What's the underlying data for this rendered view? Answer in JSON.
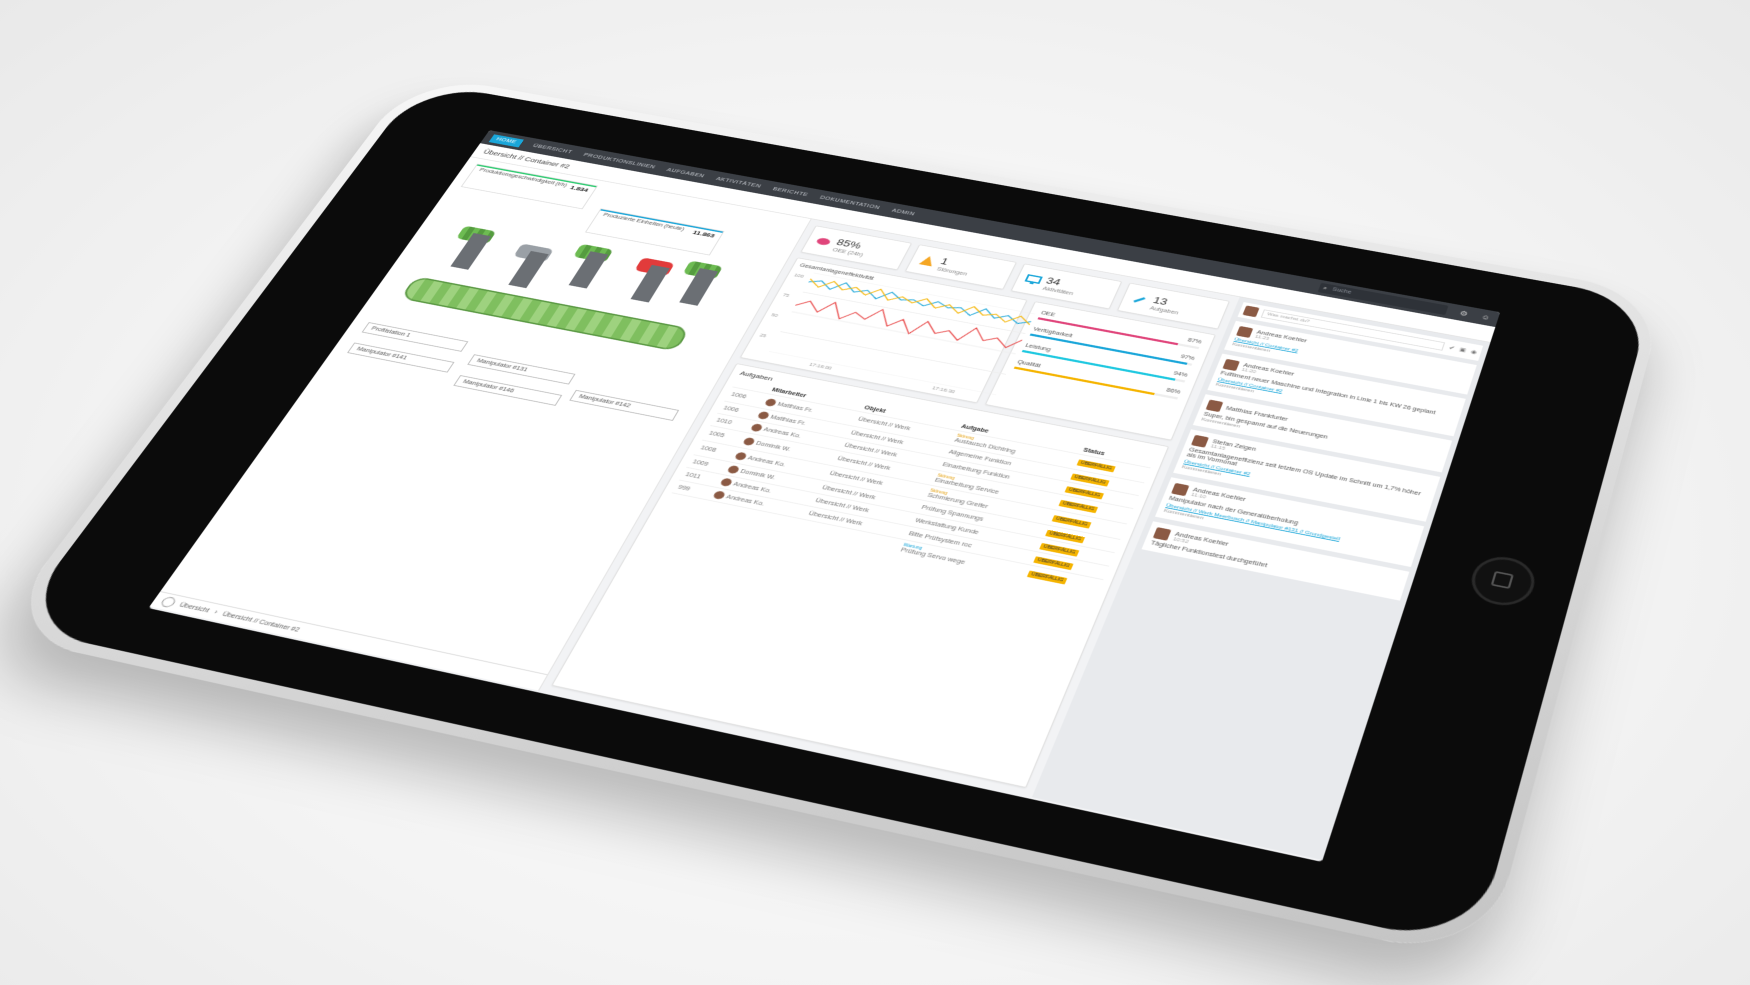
{
  "app": {
    "nav": [
      "Home",
      "Übersicht",
      "Produktionslinien",
      "Aufgaben",
      "Aktivitäten",
      "Berichte",
      "Dokumentation",
      "Admin"
    ],
    "search_placeholder": "Suche",
    "page_title": "Übersicht // Container #2"
  },
  "left_panel": {
    "kpi1": {
      "label": "Produktionsgeschwindigkeit (t/h)",
      "value": "1.834"
    },
    "kpi2": {
      "label": "Produzierte Einheiten (heute)",
      "value": "11.863"
    },
    "labels": [
      "Profilstation 1",
      "Manipulator #141",
      "Manipulator #131",
      "Manipulator #142",
      "Manipulator #146"
    ],
    "breadcrumb": [
      "Übersicht",
      "Übersicht // Container #2"
    ]
  },
  "stats": [
    {
      "icon": "brain-icon",
      "value": "85%",
      "label": "OEE (24h)",
      "color": "#e0457b"
    },
    {
      "icon": "warning-icon",
      "value": "1",
      "label": "Störungen",
      "color": "#f5a623"
    },
    {
      "icon": "monitor-icon",
      "value": "34",
      "label": "Aktivitäten",
      "color": "#1aa6d9"
    },
    {
      "icon": "wrench-icon",
      "value": "13",
      "label": "Aufgaben",
      "color": "#1aa6d9"
    }
  ],
  "chart_data": {
    "type": "line",
    "title": "Gesamtanlageneffektivität",
    "x": [
      "17:16:00",
      "17:16:30"
    ],
    "ylim": [
      0,
      100
    ],
    "yticks": [
      "100",
      "75",
      "50",
      "25"
    ],
    "series": [
      {
        "color": "#1aa6d9",
        "values": [
          88,
          92,
          84,
          95,
          86,
          91,
          83,
          94,
          87,
          90,
          85,
          93,
          88,
          91,
          84,
          95,
          86,
          92,
          85,
          90
        ]
      },
      {
        "color": "#f5b400",
        "values": [
          92,
          84,
          94,
          86,
          92,
          85,
          95,
          84,
          91,
          86,
          94,
          85,
          92,
          84,
          95,
          87,
          91,
          84,
          94,
          86
        ]
      },
      {
        "color": "#e84545",
        "values": [
          58,
          66,
          55,
          70,
          52,
          63,
          57,
          72,
          54,
          65,
          50,
          68,
          56,
          62,
          53,
          71,
          58,
          64,
          55,
          67
        ]
      }
    ]
  },
  "oee_breakdown": [
    {
      "label": "OEE",
      "value": "87%",
      "fraction": 0.87,
      "color": "#e0457b"
    },
    {
      "label": "Verfügbarkeit",
      "value": "97%",
      "fraction": 0.97,
      "color": "#1aa6d9"
    },
    {
      "label": "Leistung",
      "value": "94%",
      "fraction": 0.94,
      "color": "#1fc8e0"
    },
    {
      "label": "Qualität",
      "value": "86%",
      "fraction": 0.86,
      "color": "#f5b400"
    }
  ],
  "tasks": {
    "title": "Aufgaben",
    "columns": [
      "",
      "Mitarbeiter",
      "Objekt",
      "Aufgabe",
      "Status"
    ],
    "rows": [
      {
        "id": "1006",
        "who": "Matthias Fr.",
        "obj": "Übersicht // Werk",
        "tag": "Störung",
        "task": "Austausch Dichtring",
        "status": "ÜBERFÄLLIG"
      },
      {
        "id": "1006",
        "who": "Matthias Fr.",
        "obj": "Übersicht // Werk",
        "tag": "",
        "task": "Allgemeine Funktion",
        "status": "ÜBERFÄLLIG"
      },
      {
        "id": "1010",
        "who": "Andreas Ko.",
        "obj": "Übersicht // Werk",
        "tag": "",
        "task": "Einarbeitung Funktion",
        "status": "ÜBERFÄLLIG"
      },
      {
        "id": "1005",
        "who": "Dominik W.",
        "obj": "Übersicht // Werk",
        "tag": "Störung",
        "task": "Einarbeitung Service",
        "status": "ÜBERFÄLLIG"
      },
      {
        "id": "1008",
        "who": "Andreas Ko.",
        "obj": "Übersicht // Werk",
        "tag": "Störung",
        "task": "Schmierung Greifer",
        "status": "ÜBERFÄLLIG"
      },
      {
        "id": "1009",
        "who": "Dominik W.",
        "obj": "Übersicht // Werk",
        "tag": "",
        "task": "Prüfung Spannungs",
        "status": "ÜBERFÄLLIG"
      },
      {
        "id": "1011",
        "who": "Andreas Ko.",
        "obj": "Übersicht // Werk",
        "tag": "",
        "task": "Werkstattung Kunde",
        "status": "ÜBERFÄLLIG"
      },
      {
        "id": "999",
        "who": "Andreas Ko.",
        "obj": "Übersicht // Werk",
        "tag": "",
        "task": "Bitte Prüfsystem roc",
        "status": "ÜBERFÄLLIG"
      },
      {
        "id": "",
        "who": "",
        "obj": "",
        "tag": "Wartung",
        "task": "Prüfung Servo wege",
        "status": "ÜBERFÄLLIG"
      }
    ]
  },
  "feed": {
    "input_placeholder": "Was machst du?",
    "posts": [
      {
        "name": "Andreas Koehler",
        "time": "11:23",
        "text": "",
        "link": "Übersicht // Container #2",
        "meta": "Kommentieren"
      },
      {
        "name": "Andreas Koehler",
        "time": "11:20",
        "text": "Fulfilment neuer Maschine und Integration in Linie 1 bis KW 26 geplant",
        "link": "Übersicht // Container #2",
        "meta": "Kommentieren"
      },
      {
        "name": "Matthias Frankfurter",
        "time": "",
        "text": "Super, bin gespannt auf die Neuerungen",
        "link": "",
        "meta": "Kommentieren"
      },
      {
        "name": "Stefan Zeigen",
        "time": "11:15",
        "text": "Gesamtanlageneffizienz seit letztem OS Update im Schnitt um 1,7% höher als im Vormonat",
        "link": "Übersicht // Container #2",
        "meta": "Kommentieren"
      },
      {
        "name": "Andreas Koehler",
        "time": "11:10",
        "text": "Manipulator nach der Generalüberholung",
        "link": "Übersicht // Werk Meerbusch // Manipulator #131 // Grundgestell",
        "meta": "Kommentieren"
      },
      {
        "name": "Andreas Koehler",
        "time": "10:52",
        "text": "Täglicher Funktionstest durchgeführt",
        "link": "",
        "meta": ""
      }
    ]
  }
}
